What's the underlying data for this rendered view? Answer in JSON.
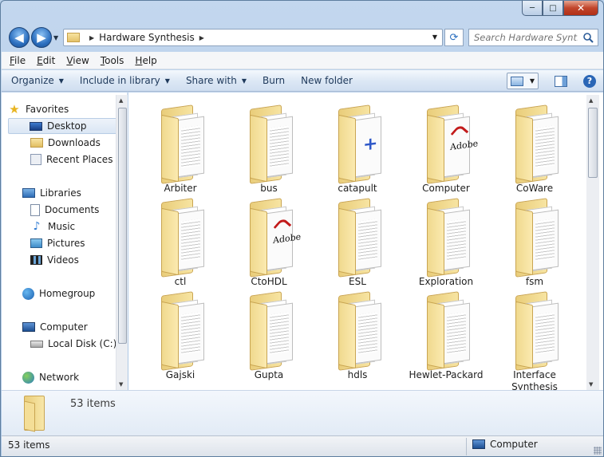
{
  "window": {
    "caption": {
      "minimize": "─",
      "maximize": "□",
      "close": "✕"
    }
  },
  "address": {
    "path": [
      "Hardware Synthesis"
    ],
    "search_placeholder": "Search Hardware Synt..."
  },
  "menubar": {
    "items": [
      {
        "label": "File",
        "accel": "F"
      },
      {
        "label": "Edit",
        "accel": "E"
      },
      {
        "label": "View",
        "accel": "V"
      },
      {
        "label": "Tools",
        "accel": "T"
      },
      {
        "label": "Help",
        "accel": "H"
      }
    ]
  },
  "commandbar": {
    "organize": "Organize",
    "include_in_library": "Include in library",
    "share_with": "Share with",
    "burn": "Burn",
    "new_folder": "New folder"
  },
  "navpane": {
    "favorites": "Favorites",
    "desktop": "Desktop",
    "downloads": "Downloads",
    "recent_places": "Recent Places",
    "libraries": "Libraries",
    "documents": "Documents",
    "music": "Music",
    "pictures": "Pictures",
    "videos": "Videos",
    "homegroup": "Homegroup",
    "computer": "Computer",
    "local_disk": "Local Disk (C:)",
    "network": "Network"
  },
  "folders": [
    {
      "name": "Arbiter",
      "preview": "doc"
    },
    {
      "name": "bus",
      "preview": "doc"
    },
    {
      "name": "catapult",
      "preview": "plus"
    },
    {
      "name": "Computer",
      "preview": "adobe"
    },
    {
      "name": "CoWare",
      "preview": "doc"
    },
    {
      "name": "ctl",
      "preview": "doc"
    },
    {
      "name": "CtoHDL",
      "preview": "adobe"
    },
    {
      "name": "ESL",
      "preview": "doc"
    },
    {
      "name": "Exploration",
      "preview": "doc"
    },
    {
      "name": "fsm",
      "preview": "doc"
    },
    {
      "name": "Gajski",
      "preview": "doc"
    },
    {
      "name": "Gupta",
      "preview": "doc"
    },
    {
      "name": "hdls",
      "preview": "doc"
    },
    {
      "name": "Hewlet-Packard",
      "preview": "doc"
    },
    {
      "name": "Interface Synthesis",
      "preview": "doc"
    }
  ],
  "details": {
    "count_text": "53 items"
  },
  "status": {
    "left": "53 items",
    "right": "Computer"
  }
}
